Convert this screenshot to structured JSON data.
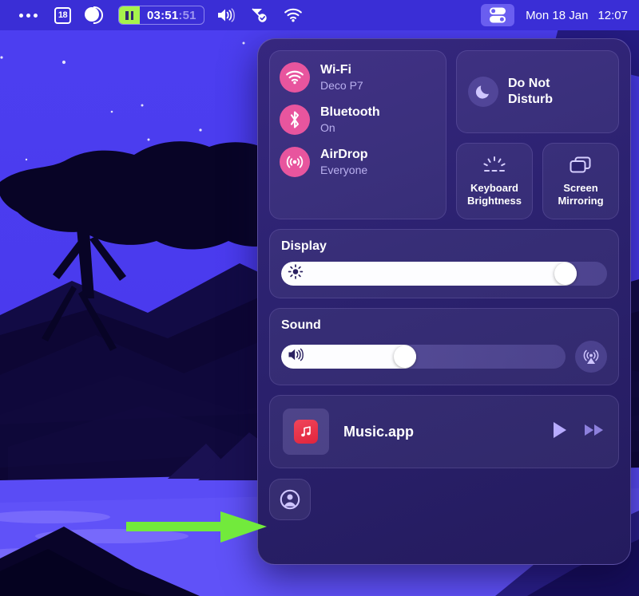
{
  "menubar": {
    "overflow_icon": "ellipsis-icon",
    "calendar_day": "18",
    "darkmode_icon": "dark-mode-circle-icon",
    "timer": {
      "pause_icon": "pause-icon",
      "hours_minutes": "03:51",
      "seconds": ":51",
      "full": "03:51:51"
    },
    "volume_icon": "speaker-waves-icon",
    "dropbox_icon": "dropbox-check-icon",
    "wifi_icon": "wifi-icon",
    "control_center_icon": "control-center-toggles-icon",
    "date": "Mon 18 Jan",
    "time": "12:07"
  },
  "control_center": {
    "connectivity": [
      {
        "label": "Wi-Fi",
        "status": "Deco P7",
        "icon": "wifi-icon"
      },
      {
        "label": "Bluetooth",
        "status": "On",
        "icon": "bluetooth-icon"
      },
      {
        "label": "AirDrop",
        "status": "Everyone",
        "icon": "airdrop-icon"
      }
    ],
    "do_not_disturb": {
      "label_line1": "Do Not",
      "label_line2": "Disturb",
      "icon": "moon-icon"
    },
    "tiles": [
      {
        "label_line1": "Keyboard",
        "label_line2": "Brightness",
        "icon": "keyboard-brightness-icon"
      },
      {
        "label_line1": "Screen",
        "label_line2": "Mirroring",
        "icon": "screen-mirroring-icon"
      }
    ],
    "display": {
      "title": "Display",
      "icon": "brightness-sun-icon",
      "value_percent": 90
    },
    "sound": {
      "title": "Sound",
      "icon": "speaker-waves-icon",
      "value_percent": 43,
      "output_button_icon": "airplay-audio-icon"
    },
    "now_playing": {
      "app_name": "Music.app",
      "app_icon": "music-note-icon",
      "play_icon": "play-icon",
      "forward_icon": "fast-forward-icon"
    },
    "user_button": {
      "icon": "user-circle-icon"
    }
  },
  "annotation": {
    "arrow_icon": "green-arrow-right",
    "color": "#72ea3c"
  },
  "colors": {
    "accent_pink": "#e8559e",
    "panel_bg": "#2c2270",
    "menubar_bg": "#3a2ed6",
    "wallpaper_sky": "#4338e8",
    "highlight": "#6a5ef0",
    "timer_green": "#a6f24c",
    "music_red": "#e0243c"
  }
}
